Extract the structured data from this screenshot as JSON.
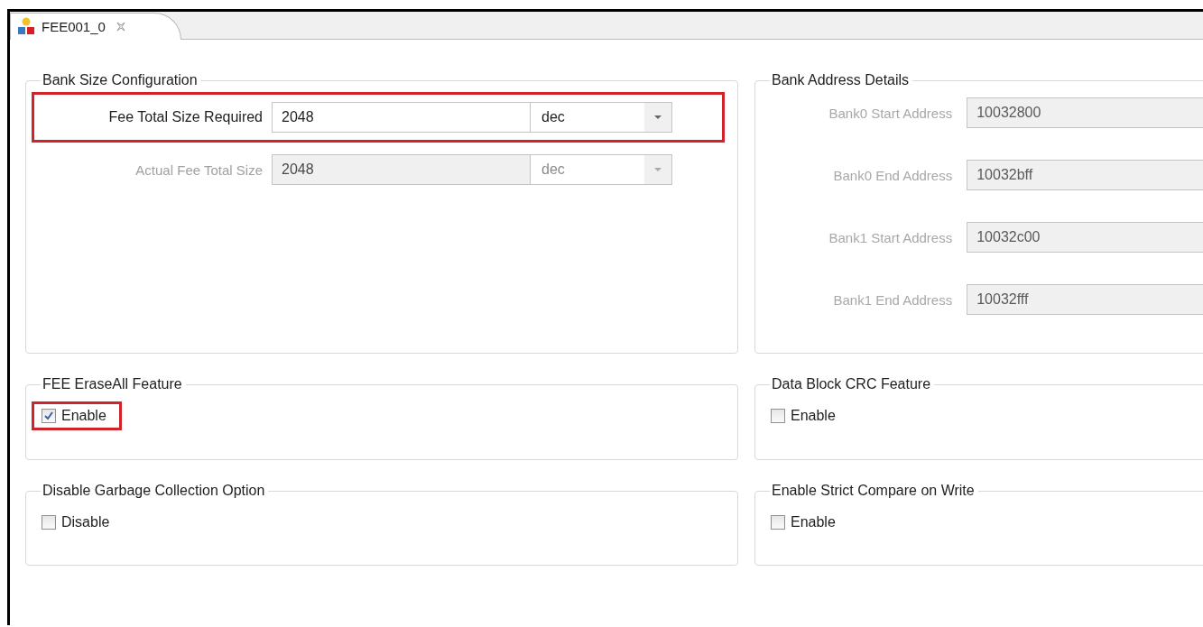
{
  "tab": {
    "title": "FEE001_0",
    "selected": true
  },
  "bank_size": {
    "title": "Bank Size Configuration",
    "rows": [
      {
        "label": "Fee Total Size Required",
        "value": "2048",
        "unit": "dec",
        "disabled": false,
        "highlighted": true
      },
      {
        "label": "Actual Fee Total Size",
        "value": "2048",
        "unit": "dec",
        "disabled": true,
        "highlighted": false
      }
    ]
  },
  "bank_address": {
    "title": "Bank Address Details",
    "rows": [
      {
        "label": "Bank0 Start Address",
        "value": "10032800",
        "disabled": true
      },
      {
        "label": "Bank0 End Address",
        "value": "10032bff",
        "disabled": true
      },
      {
        "label": "Bank1 Start Address",
        "value": "10032c00",
        "disabled": true
      },
      {
        "label": "Bank1 End Address",
        "value": "10032fff",
        "disabled": true
      }
    ]
  },
  "features": [
    {
      "title": "FEE EraseAll Feature",
      "option": {
        "label": "Enable",
        "checked": true,
        "highlighted": true
      }
    },
    {
      "title": "Data Block CRC Feature",
      "option": {
        "label": "Enable",
        "checked": false,
        "highlighted": false
      }
    },
    {
      "title": "Disable Garbage Collection Option",
      "option": {
        "label": "Disable",
        "checked": false,
        "highlighted": false
      }
    },
    {
      "title": "Enable Strict Compare on Write",
      "option": {
        "label": "Enable",
        "checked": false,
        "highlighted": false
      }
    }
  ]
}
